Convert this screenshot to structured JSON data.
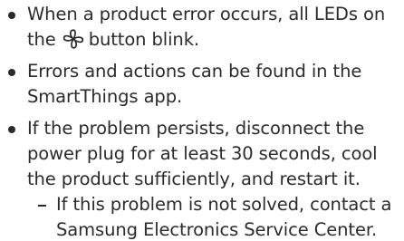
{
  "bullets": [
    {
      "line1": "When a product error occurs, all LEDs on",
      "line2_before_icon": "the",
      "icon": "fan-icon",
      "line2_after_icon": "button blink."
    },
    {
      "line1": "Errors and actions can be found in the",
      "line2": "SmartThings app."
    },
    {
      "line1": "If the problem persists, disconnect the",
      "line2": "power plug for at least 30 seconds, cool",
      "line3": "the product sufficiently, and restart it.",
      "sub": {
        "line1": "If this problem is not solved, contact a",
        "line2": "Samsung Electronics Service Center."
      }
    }
  ],
  "colors": {
    "text": "#2b2b2b",
    "background": "#ffffff"
  }
}
